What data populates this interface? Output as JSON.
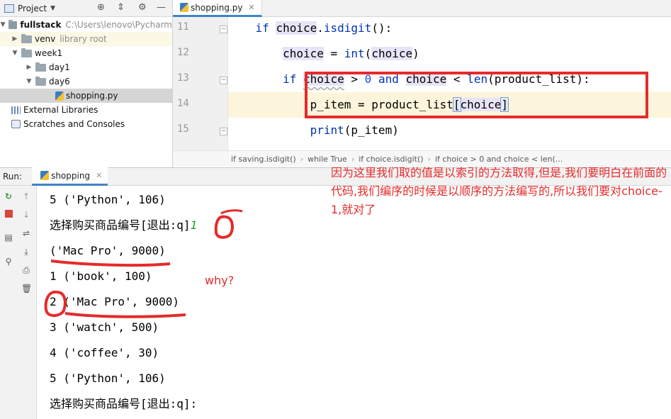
{
  "project_panel": {
    "title": "Project",
    "tree": [
      {
        "label": "fullstack",
        "extra": "C:\\Users\\lenovo\\Pycharm"
      },
      {
        "label": "venv",
        "extra": "library root"
      },
      {
        "label": "week1"
      },
      {
        "label": "day1"
      },
      {
        "label": "day6"
      },
      {
        "label": "shopping.py"
      },
      {
        "label": "External Libraries"
      },
      {
        "label": "Scratches and Consoles"
      }
    ]
  },
  "editor": {
    "tab": "shopping.py",
    "line_numbers": [
      "11",
      "12",
      "13",
      "14",
      "15"
    ],
    "breadcrumbs": [
      "if saving.isdigit()",
      "while True",
      "if choice.isdigit()",
      "if choice > 0 and choice < len(..."
    ]
  },
  "run": {
    "label": "Run:",
    "tab": "shopping"
  },
  "console": {
    "lines": [
      "5 ('Python', 106)",
      "选择购买商品编号[退出:q]",
      "('Mac Pro', 9000)",
      "1 ('book', 100)",
      "2 ('Mac Pro', 9000)",
      "3 ('watch', 500)",
      "4 ('coffee', 30)",
      "5 ('Python', 106)",
      "选择购买商品编号[退出:q]:"
    ],
    "input_echo": "1"
  },
  "annotations": {
    "main_note": "因为这里我们取的值是以索引的方法取得,但是,我们要明白在前面的代码,我们编序的时候是以顺序的方法编写的,所以我们要对choice-1,就对了",
    "why": "why?"
  },
  "colors": {
    "annotation_red": "#e52b2b",
    "keyword_blue": "#0033b3",
    "current_line": "#fcf5db"
  }
}
